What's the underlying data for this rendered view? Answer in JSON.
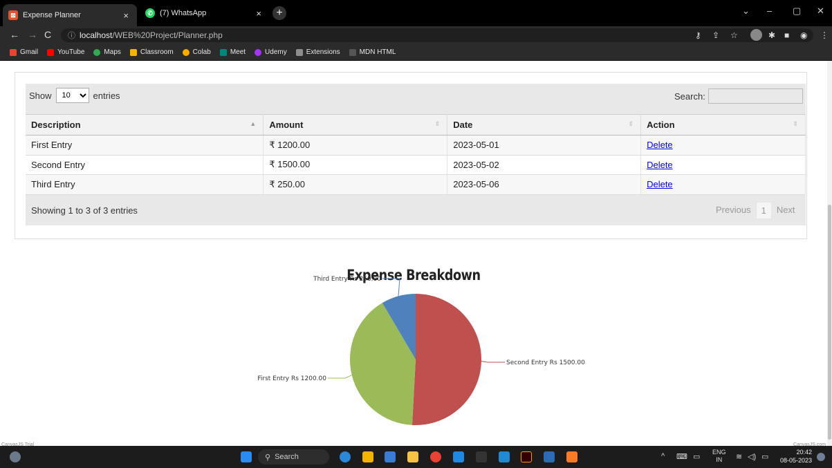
{
  "browser": {
    "tabs": [
      {
        "title": "Expense Planner",
        "active": true
      },
      {
        "title": "(7) WhatsApp",
        "active": false
      }
    ],
    "url_host": "localhost",
    "url_path": "/WEB%20Project/Planner.php",
    "bookmarks": [
      "Gmail",
      "YouTube",
      "Maps",
      "Classroom",
      "Colab",
      "Meet",
      "Udemy",
      "Extensions",
      "MDN HTML"
    ]
  },
  "table_controls": {
    "show_label": "Show",
    "entries_value": "10",
    "entries_label": "entries",
    "search_label": "Search:"
  },
  "table": {
    "headers": [
      "Description",
      "Amount",
      "Date",
      "Action"
    ],
    "rows": [
      {
        "description": "First Entry",
        "amount": "₹ 1200.00",
        "date": "2023-05-01",
        "action": "Delete"
      },
      {
        "description": "Second Entry",
        "amount": "₹ 1500.00",
        "date": "2023-05-02",
        "action": "Delete"
      },
      {
        "description": "Third Entry",
        "amount": "₹ 250.00",
        "date": "2023-05-06",
        "action": "Delete"
      }
    ],
    "info": "Showing 1 to 3 of 3 entries",
    "pager": {
      "previous": "Previous",
      "page": "1",
      "next": "Next"
    }
  },
  "chart_data": {
    "type": "pie",
    "title": "Expense Breakdown",
    "slices": [
      {
        "label": "Second Entry Rs 1500.00",
        "value": 1500,
        "color": "#C0504E"
      },
      {
        "label": "First Entry Rs 1200.00",
        "value": 1200,
        "color": "#9BBB58"
      },
      {
        "label": "Third Entry Rs 250.00",
        "value": 250,
        "color": "#4F81BC"
      }
    ]
  },
  "credits": {
    "left": "CanvasJS Trial",
    "right": "CanvasJS.com"
  },
  "taskbar": {
    "search": "Search",
    "lang": "ENG",
    "region": "IN",
    "time": "20:42",
    "date": "08-05-2023"
  }
}
